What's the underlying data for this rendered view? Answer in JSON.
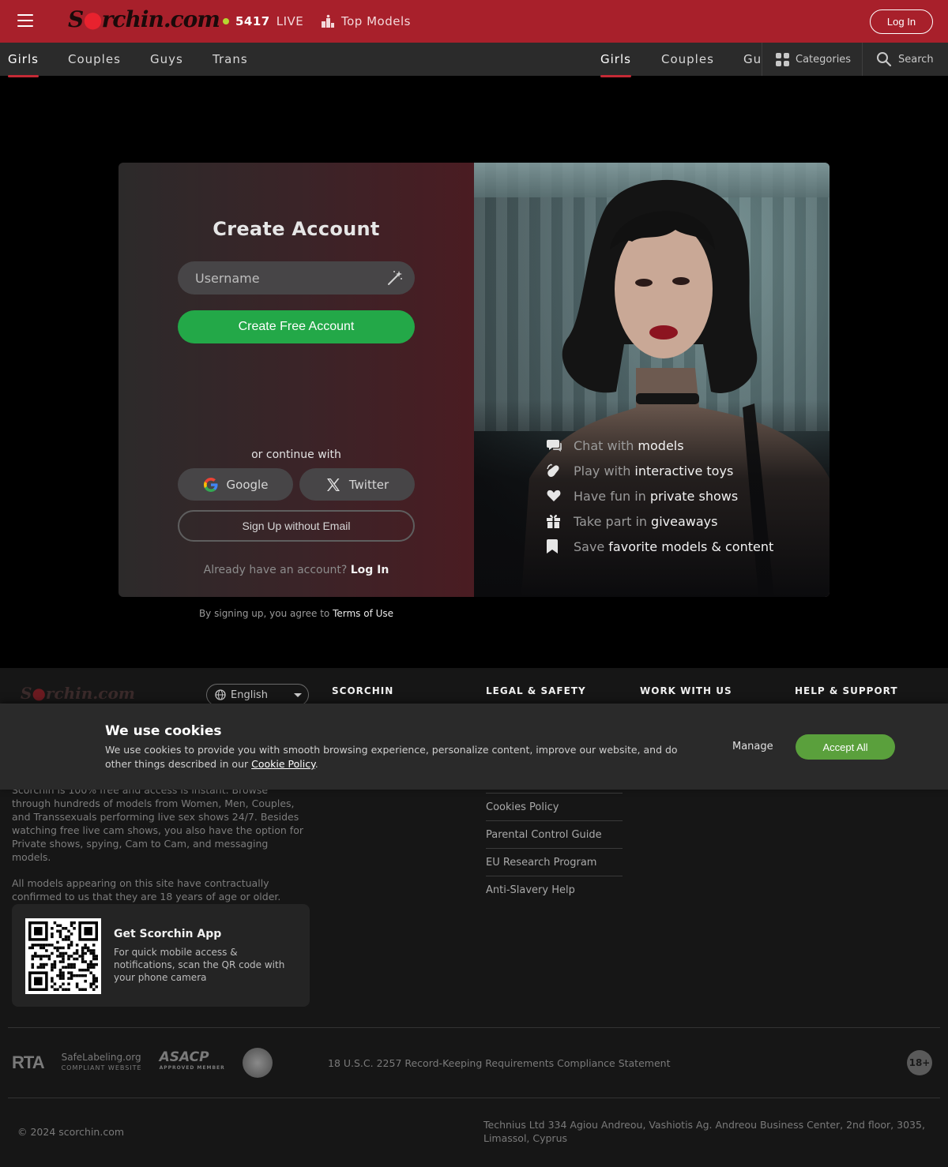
{
  "header": {
    "logo_text": "Scorchin.com",
    "live_count": "5417",
    "live_label": "LIVE",
    "top_models": "Top Models",
    "login": "Log In",
    "colors": {
      "brand": "#a8202b",
      "live_dot": "#b6d631"
    }
  },
  "categories_left": [
    "Girls",
    "Couples",
    "Guys",
    "Trans"
  ],
  "categories_right": [
    "Girls",
    "Couples",
    "Gu"
  ],
  "tools": {
    "categories": "Categories",
    "search": "Search"
  },
  "signup": {
    "title": "Create Account",
    "username_placeholder": "Username",
    "cta": "Create Free Account",
    "or_continue": "or continue with",
    "google": "Google",
    "twitter": "Twitter",
    "no_email": "Sign Up without Email",
    "already_text": "Already have an account?",
    "already_link": "Log In",
    "terms_text": "By signing up, you agree to",
    "terms_link": "Terms of Use",
    "cta_color": "#23a848"
  },
  "features": [
    {
      "icon": "chat-icon",
      "pre": "Chat with",
      "bold": "models"
    },
    {
      "icon": "toy-icon",
      "pre": "Play with",
      "bold": "interactive toys"
    },
    {
      "icon": "heart-icon",
      "pre": "Have fun in",
      "bold": "private shows"
    },
    {
      "icon": "gift-icon",
      "pre": "Take part in",
      "bold": "giveaways"
    },
    {
      "icon": "bookmark-icon",
      "pre": "Save",
      "bold": "favorite models & content"
    }
  ],
  "footer": {
    "logo_text": "Scorchin.com",
    "language": "English",
    "headings": [
      "SCORCHIN",
      "LEGAL & SAFETY",
      "WORK WITH US",
      "HELP & SUPPORT"
    ],
    "about_1": "Scorchin is 100% free and access is instant. Browse through hundreds of models from Women, Men, Couples, and Transsexuals performing live sex shows 24/7. Besides watching free live cam shows, you also have the option for Private shows, spying, Cam to Cam, and messaging models.",
    "about_2": "All models appearing on this site have contractually confirmed to us that they are 18 years of age or older.",
    "app_title": "Get Scorchin App",
    "app_desc": "For quick mobile access & notifications, scan the QR code with your phone camera",
    "legal_links": [
      "Cookies Policy",
      "Parental Control Guide",
      "EU Research Program",
      "Anti-Slavery Help"
    ],
    "badge_rta": "RTA",
    "badge_safe": "SafeLabeling.org",
    "badge_safe_sub": "COMPLIANT WEBSITE",
    "badge_asacp": "ASACP",
    "badge_asacp_sub": "APPROVED MEMBER",
    "compliance": "18 U.S.C. 2257 Record-Keeping Requirements Compliance Statement",
    "age_badge": "18+",
    "copyright": "© 2024 scorchin.com",
    "address": "Technius Ltd 334 Agiou Andreou, Vashiotis Ag. Andreou Business Center, 2nd floor, 3035, Limassol, Cyprus"
  },
  "cookie": {
    "title": "We use cookies",
    "text": "We use cookies to provide you with smooth browsing experience, personalize content, improve our website, and do other things described in our",
    "link": "Cookie Policy",
    "manage": "Manage",
    "accept": "Accept All",
    "accept_color": "#5aa03c"
  }
}
